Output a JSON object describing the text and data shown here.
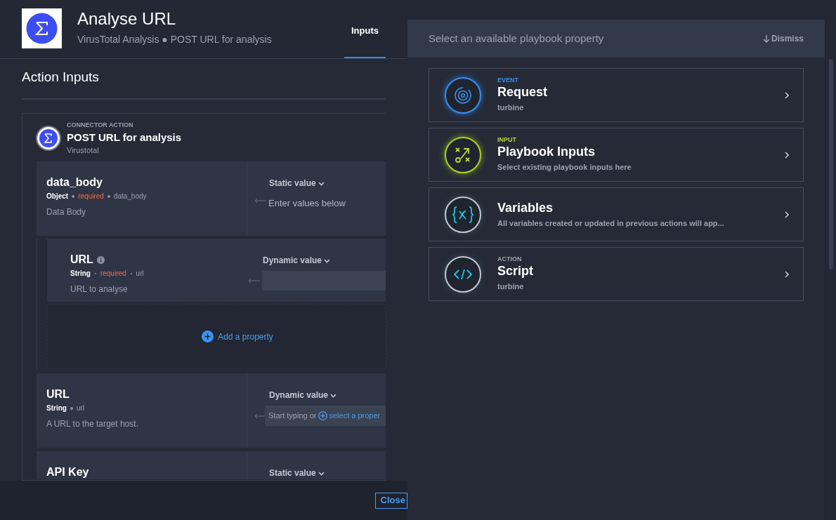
{
  "header": {
    "title": "Analyse URL",
    "subtitle": "VirusTotal Analysis ● POST URL for analysis"
  },
  "tabs": [
    {
      "label": "Inputs",
      "selected": true
    }
  ],
  "section_title": "Action Inputs",
  "action": {
    "eyebrow": "CONNECTOR ACTION",
    "title": "POST URL for analysis",
    "connector": "Virustotal"
  },
  "inputs": [
    {
      "name": "data_body",
      "type": "Object",
      "status": "required",
      "key": "data_body",
      "description": "Data Body",
      "mode": "Static value",
      "kind": "text",
      "value": "Enter values below",
      "children": [
        {
          "name": "URL",
          "info": true,
          "type": "String",
          "status": "required",
          "key": "url",
          "description": "URL to analyse",
          "mode": "Dynamic value",
          "kind": "blank"
        }
      ],
      "add_label": "Add a property"
    },
    {
      "name": "URL",
      "type": "String",
      "key": "url",
      "description": "A URL to the target host.",
      "mode": "Dynamic value",
      "kind": "field",
      "placeholder": "Start typing or",
      "link": "select a proper"
    },
    {
      "name": "API Key",
      "mode": "Static value",
      "kind": "header"
    }
  ],
  "footer": {
    "close": "Close"
  },
  "panel": {
    "title": "Select an available playbook property",
    "dismiss": "Dismiss",
    "items": [
      {
        "kind": "event",
        "eyebrow": "EVENT",
        "title": "Request",
        "subtitle": "turbine"
      },
      {
        "kind": "input",
        "eyebrow": "INPUT",
        "title": "Playbook Inputs",
        "subtitle": "Select existing playbook inputs here"
      },
      {
        "kind": "variables",
        "title": "Variables",
        "subtitle": "All variables created or updated in previous actions will app..."
      },
      {
        "kind": "script",
        "eyebrow": "ACTION",
        "title": "Script",
        "subtitle": "turbine"
      }
    ]
  }
}
